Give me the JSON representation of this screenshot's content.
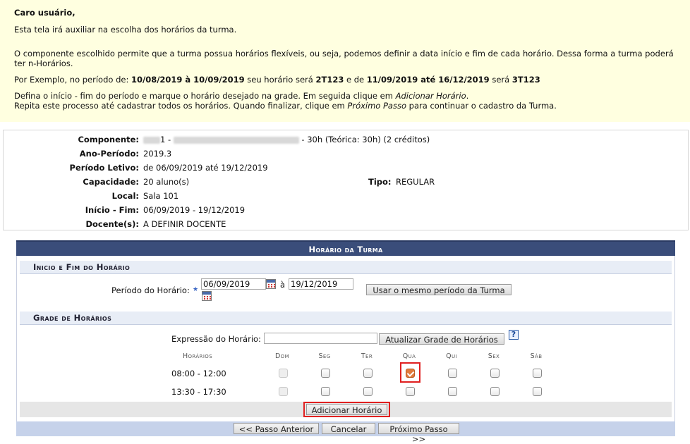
{
  "info": {
    "greeting": "Caro usuário,",
    "line1": "Esta tela irá auxiliar na escolha dos horários da turma.",
    "line2": "O componente escolhido permite que a turma possua horários flexíveis, ou seja, podemos definir a data início e fim de cada horário. Dessa forma a turma poderá ter n-Horários.",
    "example": {
      "prefix": "Por Exemplo, no período de: ",
      "period1": "10/08/2019 à 10/09/2019",
      "mid1": " seu horário será ",
      "code1": "2T123",
      "mid2": " e de ",
      "period2": "11/09/2019 até 16/12/2019",
      "mid3": " será ",
      "code2": "3T123"
    },
    "instr1_a": "Defina o início - fim do período e marque o horário desejado na grade. Em seguida clique em ",
    "instr1_b": "Adicionar Horário",
    "instr1_c": ".",
    "instr2_a": "Repita este processo até cadastrar todos os horários. Quando finalizar, clique em ",
    "instr2_b": "Próximo Passo",
    "instr2_c": " para continuar o cadastro da Turma."
  },
  "details": {
    "componente_label": "Componente:",
    "componente_a": "1 - ",
    "componente_b": " - 30h (Teórica: 30h) (2 créditos)",
    "ano_label": "Ano-Período:",
    "ano_value": "2019.3",
    "periodo_label": "Período Letivo:",
    "periodo_value": "de 06/09/2019 até 19/12/2019",
    "capacidade_label": "Capacidade:",
    "capacidade_value": "20 aluno(s)",
    "tipo_label": "Tipo:",
    "tipo_value": "REGULAR",
    "local_label": "Local:",
    "local_value": "Sala 101",
    "inicio_label": "Início - Fim:",
    "inicio_value": "06/09/2019 - 19/12/2019",
    "docente_label": "Docente(s):",
    "docente_value": "A DEFINIR DOCENTE"
  },
  "form": {
    "title": "Horário da Turma",
    "sec1_title": "Inicio e Fim do Horário",
    "periodo_label": "Período do Horário:",
    "start_date": "06/09/2019",
    "sep": "à",
    "end_date": "19/12/2019",
    "same_period_button": "Usar o mesmo período da Turma",
    "sec2_title": "Grade de Horários",
    "expressao_label": "Expressão do Horário:",
    "expressao_value": "",
    "atualizar_button": "Atualizar Grade de Horários",
    "help": "?",
    "horarios_header": "Horários",
    "days": [
      "Dom",
      "Seg",
      "Ter",
      "Qua",
      "Qui",
      "Sex",
      "Sáb"
    ],
    "slots": [
      "08:00 - 12:00",
      "13:30 - 17:30"
    ],
    "checked": {
      "slot": 0,
      "day": "Qua"
    },
    "add_button": "Adicionar Horário"
  },
  "nav": {
    "prev": "<< Passo Anterior",
    "cancel": "Cancelar",
    "next": "Próximo Passo >>"
  },
  "colors": {
    "info_bg": "#ffffe0",
    "header_bg": "#3a4d7a",
    "section_bg": "#e8edf6",
    "footer_bg": "#c6d2ea",
    "highlight": "#e02020",
    "checked": "#e07a3c"
  }
}
